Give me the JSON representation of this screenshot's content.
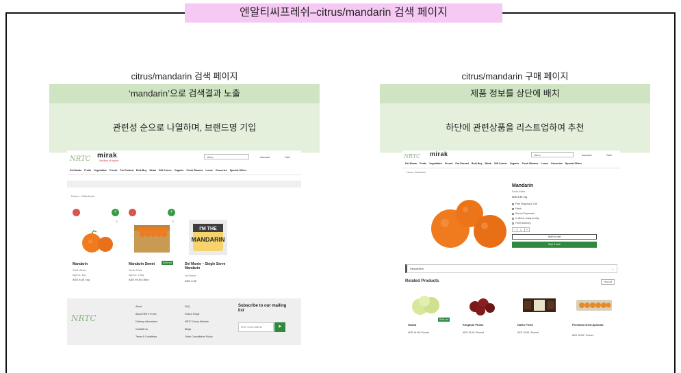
{
  "slide_title": "엔알티씨프레쉬–citrus/mandarin 검색 페이지",
  "left_panel": {
    "caption": "citrus/mandarin 검색 페이지",
    "heading": "‘mandarin’으로 검색결과 노출",
    "body": "관련성 순으로 나열하며, 브랜드명 기입"
  },
  "right_panel": {
    "caption": "citrus/mandarin 구매 페이지",
    "heading": "제품 정보를 상단에 배치",
    "body": "하단에 관련상품을 리스트업하여 추천"
  },
  "site": {
    "logo_nrtc": "NRTC",
    "logo_mirak": "mirak",
    "logo_sub": "The Best of Nature",
    "account": "Account",
    "cart": "Cart",
    "nav": [
      "Del Monte",
      "Fruits",
      "Vegetables",
      "Prenut",
      "Pre-Packed",
      "Bulk Buy",
      "Mirak",
      "Gift Corner",
      "Organic",
      "Fresh Blooms",
      "Loose",
      "Groceries",
      "Special Offers"
    ]
  },
  "search_page": {
    "search_value": "citrus",
    "breadcrumb": [
      "Home",
      "›",
      "Collections"
    ],
    "products": [
      {
        "name": "Mandarin",
        "brand": "South Africa",
        "unit": "Approx. 1kg",
        "price": "AED 8.45 / kg",
        "badge": "-",
        "tag": ""
      },
      {
        "name": "Mandarin Sweet",
        "brand": "South Africa",
        "unit": "Approx. 1.5kg",
        "price": "AED 49.00 | Box",
        "badge": "-",
        "tag": "Sold out"
      },
      {
        "name": "Del Monte – Single Serve Mandarin",
        "brand": "Del Monte",
        "unit": "",
        "price": "AED 2.50",
        "badge": "",
        "tag": ""
      }
    ],
    "footer": {
      "logo": "NRTC",
      "col1": [
        "About",
        "About NRTC Fresh",
        "Delivery Information",
        "Contact Us",
        "Terms & Conditions"
      ],
      "col2": [
        "FAQ",
        "Return Policy",
        "NRTC Group Website",
        "Blogs",
        "Order Cancellation Policy"
      ],
      "subscribe_title": "Subscribe to our mailing list",
      "subscribe_placeholder": "Enter email address",
      "subscribe_btn": "➤"
    }
  },
  "product_page": {
    "search_value": "citrus",
    "breadcrumb": [
      "Home",
      "›",
      "Mandarin"
    ],
    "title": "Mandarin",
    "origin": "South Africa",
    "price": "AED 8.45 / kg",
    "options": [
      "Free Shipping & Gift",
      "Fresh",
      "Secure Payments",
      "In Stock, ready to ship",
      "Fresh Delivery"
    ],
    "qty": "1",
    "add_to_cart": "Add to cart",
    "buy_now": "Buy it now",
    "description": "Description",
    "related_title": "Related Products",
    "view_all": "View All",
    "related": [
      {
        "name": "Guava",
        "price": "AED 16.95 / Punnet",
        "tag": "Sold out"
      },
      {
        "name": "Kingdom Plums",
        "price": "AED 19.95 / Punnet",
        "tag": ""
      },
      {
        "name": "Dates Fresh",
        "price": "AED 19.95 / Punnet",
        "tag": ""
      },
      {
        "name": "Premium Dried Apricots",
        "price": "AED 18.95 / Punnet",
        "tag": ""
      }
    ]
  },
  "colors": {
    "banner": "#f6c9f4",
    "panel_head": "#cfe4c2",
    "panel_body": "#e4efdc",
    "brand_green": "#2f8a3f",
    "badge_red": "#d9534f"
  }
}
